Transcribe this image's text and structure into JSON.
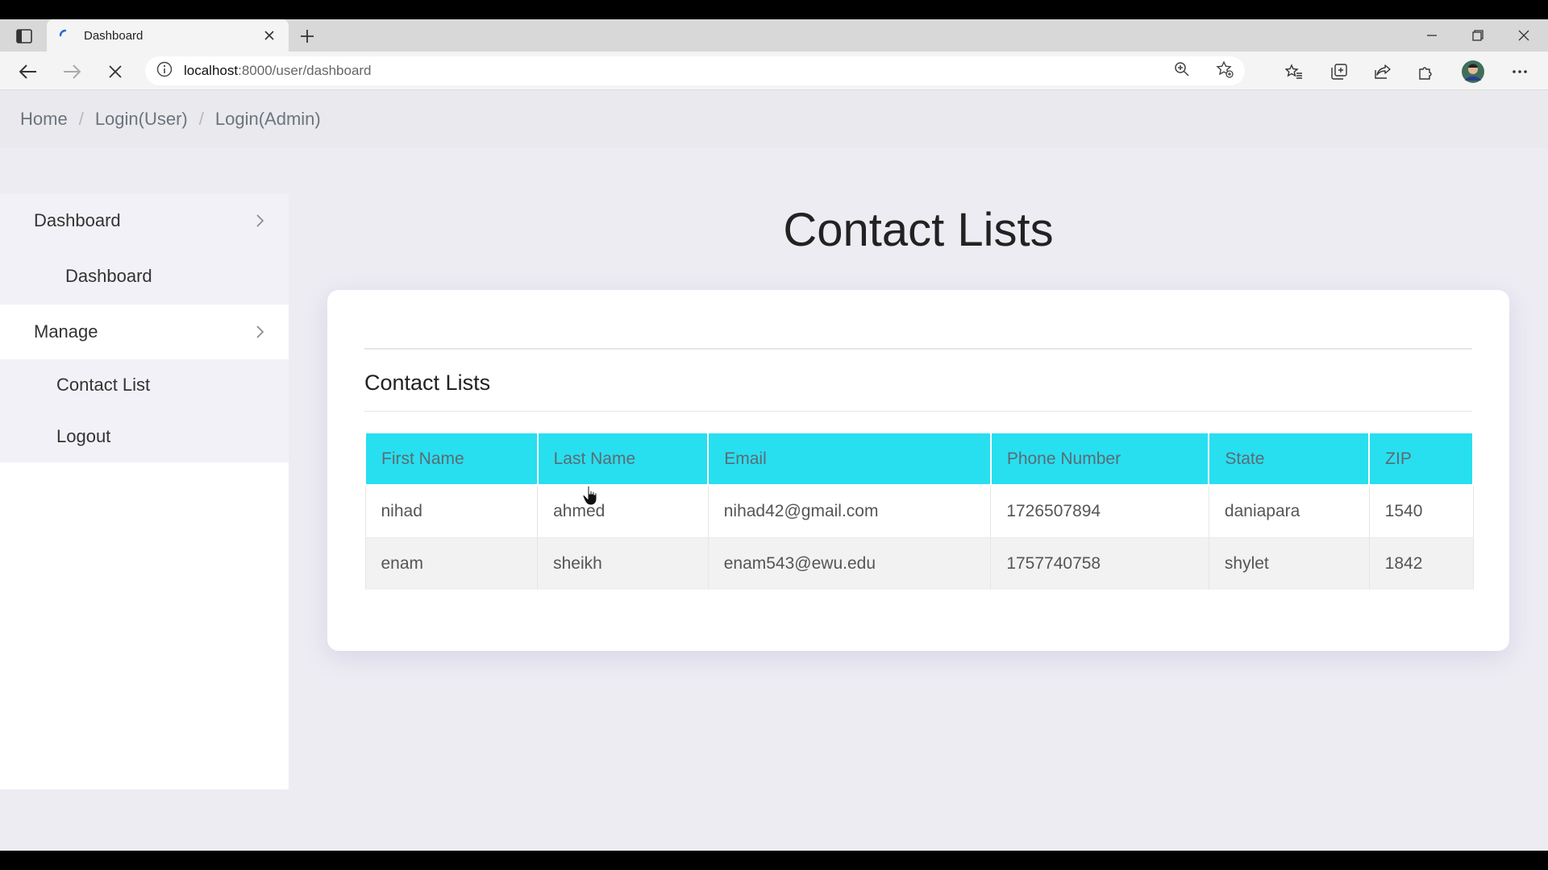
{
  "browser": {
    "tab_title": "Dashboard",
    "url_host": "localhost",
    "url_rest": ":8000/user/dashboard"
  },
  "breadcrumb": {
    "items": [
      "Home",
      "Login(User)",
      "Login(Admin)"
    ],
    "separator": "/"
  },
  "sidebar": {
    "group1_label": "Dashboard",
    "group1_items": [
      "Dashboard"
    ],
    "group2_label": "Manage",
    "group2_items": [
      "Contact List",
      "Logout"
    ]
  },
  "main": {
    "page_title": "Contact Lists",
    "card_title": "Contact Lists",
    "table": {
      "headers": [
        "First Name",
        "Last Name",
        "Email",
        "Phone Number",
        "State",
        "ZIP"
      ],
      "rows": [
        [
          "nihad",
          "ahmed",
          "nihad42@gmail.com",
          "1726507894",
          "daniapara",
          "1540"
        ],
        [
          "enam",
          "sheikh",
          "enam543@ewu.edu",
          "1757740758",
          "shylet",
          "1842"
        ]
      ]
    }
  },
  "colors": {
    "table_header": "#28dff0",
    "page_background": "#edecf3",
    "sidebar_active": "#f2f1f7"
  }
}
